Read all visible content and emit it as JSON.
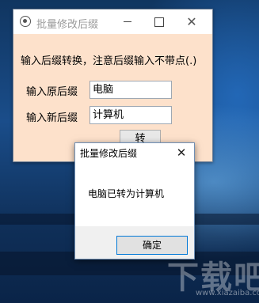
{
  "main_window": {
    "title": "批量修改后缀",
    "icon": "app-icon",
    "instruction": "输入后缀转换，注意后缀输入不带点(.)",
    "old_suffix_label": "输入原后缀",
    "old_suffix_value": "电脑",
    "new_suffix_label": "输入新后缀",
    "new_suffix_value": "计算机",
    "convert_button_label": "转",
    "background_color": "#fde1cb"
  },
  "message_box": {
    "title": "批量修改后缀",
    "message": "电脑已转为计算机",
    "ok_label": "确定",
    "close_icon": "close-icon"
  },
  "watermark": {
    "big_text": "下载吧",
    "small_text": "www.xiazaiba.com"
  }
}
